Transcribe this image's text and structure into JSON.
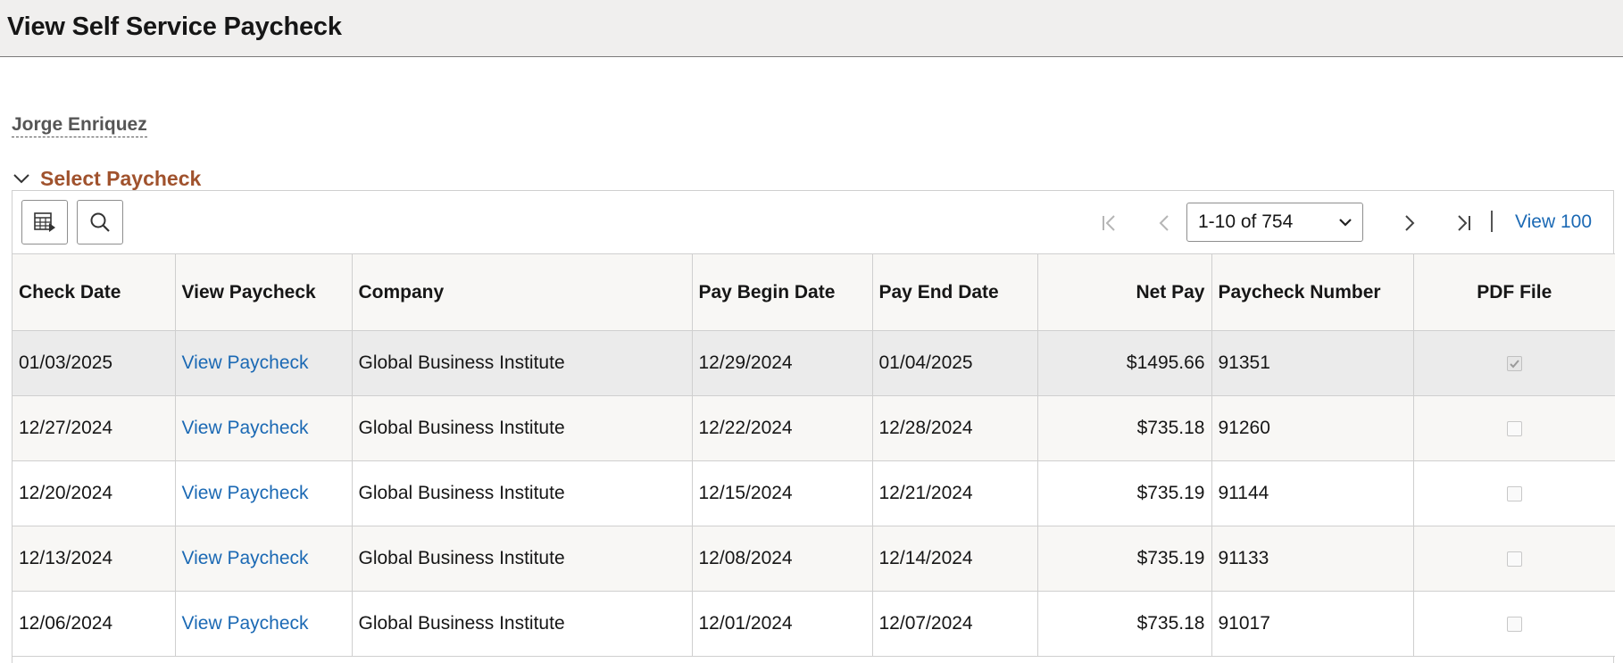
{
  "page": {
    "title": "View Self Service Paycheck"
  },
  "employee": {
    "name": "Jorge Enriquez"
  },
  "section": {
    "title": "Select Paycheck"
  },
  "pager": {
    "range": "1-10 of 754",
    "view_all": "View 100"
  },
  "icons": {
    "grid_settings": "grid-settings-icon",
    "search": "search-icon",
    "first": "first-page-icon",
    "previous": "previous-page-icon",
    "next": "next-page-icon",
    "last": "last-page-icon"
  },
  "colors": {
    "link": "#1b69b4",
    "section_title": "#a0522d",
    "header_bg": "#f0efee"
  },
  "table": {
    "columns": [
      "Check Date",
      "View Paycheck",
      "Company",
      "Pay Begin Date",
      "Pay End Date",
      "Net Pay",
      "Paycheck Number",
      "PDF File"
    ],
    "rows": [
      {
        "check_date": "01/03/2025",
        "view": "View Paycheck",
        "company": "Global Business Institute",
        "begin": "12/29/2024",
        "end": "01/04/2025",
        "net_pay": "$1495.66",
        "number": "91351",
        "pdf": true
      },
      {
        "check_date": "12/27/2024",
        "view": "View Paycheck",
        "company": "Global Business Institute",
        "begin": "12/22/2024",
        "end": "12/28/2024",
        "net_pay": "$735.18",
        "number": "91260",
        "pdf": false
      },
      {
        "check_date": "12/20/2024",
        "view": "View Paycheck",
        "company": "Global Business Institute",
        "begin": "12/15/2024",
        "end": "12/21/2024",
        "net_pay": "$735.19",
        "number": "91144",
        "pdf": false
      },
      {
        "check_date": "12/13/2024",
        "view": "View Paycheck",
        "company": "Global Business Institute",
        "begin": "12/08/2024",
        "end": "12/14/2024",
        "net_pay": "$735.19",
        "number": "91133",
        "pdf": false
      },
      {
        "check_date": "12/06/2024",
        "view": "View Paycheck",
        "company": "Global Business Institute",
        "begin": "12/01/2024",
        "end": "12/07/2024",
        "net_pay": "$735.18",
        "number": "91017",
        "pdf": false
      }
    ]
  }
}
